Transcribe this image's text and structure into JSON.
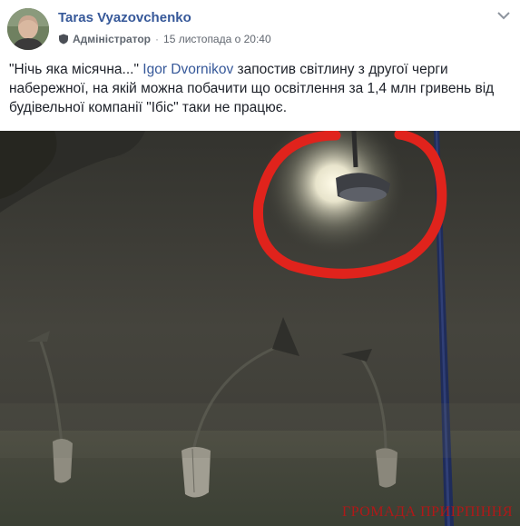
{
  "post": {
    "author": "Taras Vyazovchenko",
    "role": "Адміністратор",
    "timestamp": "15 листопада о 20:40",
    "text_part1": "\"Нічь яка місячна...\" ",
    "mention": "Igor Dvornikov",
    "text_part2": " запостив світлину з другої черги набережної, на якій можна побачити що освітлення за 1,4 млн гривень від будівельної компанії \"Ібіс\" таки не працює."
  },
  "photo": {
    "watermark": "ГРОМАДА ПРИІРПІННЯ"
  },
  "icons": {
    "admin": "shield-icon",
    "menu": "chevron-down-icon"
  },
  "colors": {
    "link": "#365899",
    "annotation_circle": "#e0231c"
  }
}
